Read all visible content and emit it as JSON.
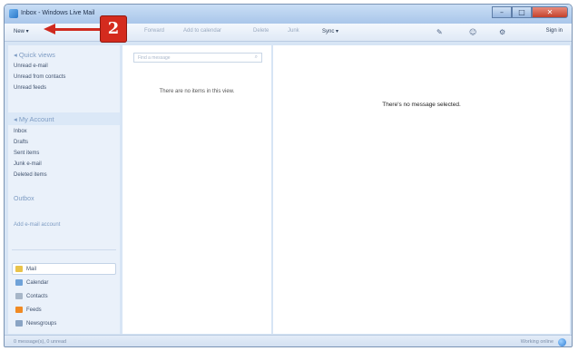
{
  "window": {
    "title": "Inbox - Windows Live Mail"
  },
  "window_controls": {
    "minimize": "–",
    "maximize": "□",
    "close": "✕"
  },
  "toolbar": {
    "new": "New ▾",
    "forward": "Forward",
    "add_to_calendar": "Add to calendar",
    "delete": "Delete",
    "junk": "Junk",
    "sync": "Sync ▾",
    "sign_in": "Sign in",
    "icons": [
      "pen-icon",
      "people-icon",
      "gear-icon"
    ]
  },
  "sidebar": {
    "quick_views": {
      "header": "◂ Quick views",
      "items": [
        "Unread e-mail",
        "Unread from contacts",
        "Unread feeds"
      ]
    },
    "account": {
      "header": "◂ My Account",
      "items": [
        "Inbox",
        "Drafts",
        "Sent items",
        "Junk e-mail",
        "Deleted items"
      ]
    },
    "outbox": "Outbox",
    "add_account": "Add e-mail account",
    "modules": [
      "Mail",
      "Calendar",
      "Contacts",
      "Feeds",
      "Newsgroups"
    ]
  },
  "message_list": {
    "search_placeholder": "Find a message",
    "empty_text": "There are no items in this view."
  },
  "reading_pane": {
    "empty_text": "There's no message selected."
  },
  "statusbar": {
    "left": "0 message(s), 0 unread",
    "right": "Working online"
  },
  "callout": {
    "number": "2"
  },
  "colors": {
    "callout": "#d42b1e",
    "accent": "#7e9cc3"
  }
}
